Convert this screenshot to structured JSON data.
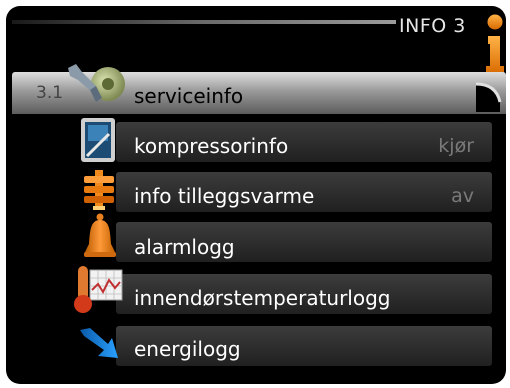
{
  "header": {
    "title": "INFO 3"
  },
  "menu": {
    "selected_number": "3.1",
    "items": [
      {
        "label": "serviceinfo",
        "value": ""
      },
      {
        "label": "kompressorinfo",
        "value": "kjør"
      },
      {
        "label": "info tilleggsvarme",
        "value": "av"
      },
      {
        "label": "alarmlogg",
        "value": ""
      },
      {
        "label": "innendørstemperaturlogg",
        "value": ""
      },
      {
        "label": "energilogg",
        "value": ""
      }
    ]
  },
  "icons": {
    "header": "info-icon",
    "items": [
      "service-tools-icon",
      "compressor-display-icon",
      "heater-icon",
      "alarm-bell-icon",
      "thermometer-graph-icon",
      "energy-arrow-icon"
    ]
  },
  "colors": {
    "selected_row": "#9a9a9a",
    "icon_orange": "#f08a1c",
    "background": "#000000"
  }
}
